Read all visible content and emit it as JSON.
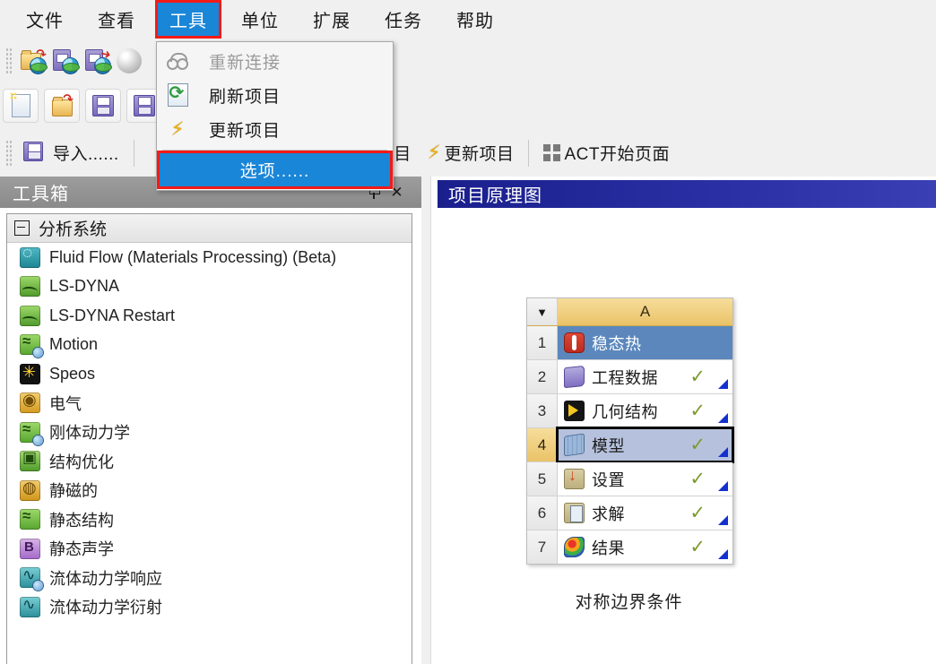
{
  "menubar": {
    "items": [
      {
        "label": "文件",
        "active": false
      },
      {
        "label": "查看",
        "active": false
      },
      {
        "label": "工具",
        "active": true
      },
      {
        "label": "单位",
        "active": false
      },
      {
        "label": "扩展",
        "active": false
      },
      {
        "label": "任务",
        "active": false
      },
      {
        "label": "帮助",
        "active": false
      }
    ]
  },
  "tools_menu": {
    "items": [
      {
        "label": "重新连接",
        "icon": "reconnect-icon",
        "state": "disabled"
      },
      {
        "label": "刷新项目",
        "icon": "refresh-project-icon",
        "state": "enabled"
      },
      {
        "label": "更新项目",
        "icon": "update-project-icon",
        "state": "enabled"
      },
      {
        "label": "选项......",
        "icon": "none",
        "state": "highlighted"
      }
    ]
  },
  "toolbar_row1": {
    "icons": [
      "restore-archive-icon",
      "archive-project-icon",
      "export-project-icon",
      "sphere-icon"
    ]
  },
  "toolbar_row2": {
    "icons": [
      "new-project-icon",
      "open-project-icon",
      "save-project-icon",
      "save-as-project-icon"
    ]
  },
  "toolbar_row3": {
    "import_label": "导入......",
    "refresh_label": "项目",
    "update_label": "更新项目",
    "act_label": "ACT开始页面"
  },
  "toolbox": {
    "title": "工具箱",
    "pin_icon": "pin-icon",
    "close_icon": "close-icon",
    "group_label": "分析系统",
    "items": [
      {
        "label": "Fluid Flow (Materials Processing) (Beta)",
        "icon": "fluid-flow-materials-processing-icon",
        "color": "#2a93a0",
        "badge": false
      },
      {
        "label": "LS-DYNA",
        "icon": "ls-dyna-icon",
        "color": "#5ea32d",
        "badge": false
      },
      {
        "label": "LS-DYNA Restart",
        "icon": "ls-dyna-restart-icon",
        "color": "#5ea32d",
        "badge": false
      },
      {
        "label": "Motion",
        "icon": "motion-icon",
        "color": "#63a830",
        "badge": true
      },
      {
        "label": "Speos",
        "icon": "speos-icon",
        "color": "#121212",
        "badge": false
      },
      {
        "label": "电气",
        "icon": "electric-icon",
        "color": "#d39a1f",
        "badge": false
      },
      {
        "label": "刚体动力学",
        "icon": "rigid-body-dynamics-icon",
        "color": "#63a830",
        "badge": true
      },
      {
        "label": "结构优化",
        "icon": "structural-optimization-icon",
        "color": "#4f9a2a",
        "badge": false
      },
      {
        "label": "静磁的",
        "icon": "magnetostatic-icon",
        "color": "#cf9418",
        "badge": false
      },
      {
        "label": "静态结构",
        "icon": "static-structural-icon",
        "color": "#63a830",
        "badge": false
      },
      {
        "label": "静态声学",
        "icon": "static-acoustics-icon",
        "color": "#a368c8",
        "badge": false
      },
      {
        "label": "流体动力学响应",
        "icon": "hydrodynamic-response-icon",
        "color": "#2a8e99",
        "badge": true
      },
      {
        "label": "流体动力学衍射",
        "icon": "hydrodynamic-diffraction-icon",
        "color": "#2a8e99",
        "badge": false
      }
    ]
  },
  "project_schematic": {
    "title": "项目原理图",
    "caption": "对称边界条件",
    "column_header": "A",
    "rows": [
      {
        "num": "1",
        "label": "稳态热",
        "icon": "steady-state-thermal-icon",
        "check": false,
        "triangle": false,
        "state": "selected"
      },
      {
        "num": "2",
        "label": "工程数据",
        "icon": "engineering-data-icon",
        "check": true,
        "triangle": true,
        "state": "normal"
      },
      {
        "num": "3",
        "label": "几何结构",
        "icon": "geometry-icon",
        "check": true,
        "triangle": true,
        "state": "normal"
      },
      {
        "num": "4",
        "label": "模型",
        "icon": "model-icon",
        "check": true,
        "triangle": true,
        "state": "active"
      },
      {
        "num": "5",
        "label": "设置",
        "icon": "setup-icon",
        "check": true,
        "triangle": true,
        "state": "normal"
      },
      {
        "num": "6",
        "label": "求解",
        "icon": "solution-icon",
        "check": true,
        "triangle": true,
        "state": "normal"
      },
      {
        "num": "7",
        "label": "结果",
        "icon": "results-icon",
        "check": true,
        "triangle": true,
        "state": "normal"
      }
    ]
  },
  "colors": {
    "menu_highlight": "#1a86d8",
    "annotation_red": "#f41a17",
    "schematic_header_blue": "#2b31a5",
    "row_selected_blue": "#5b87bc",
    "row_active_lavender": "#b6c2dd",
    "column_header_gold": "#eac368",
    "check_olive": "#7d9a2e",
    "triangle_blue": "#1431cf"
  }
}
